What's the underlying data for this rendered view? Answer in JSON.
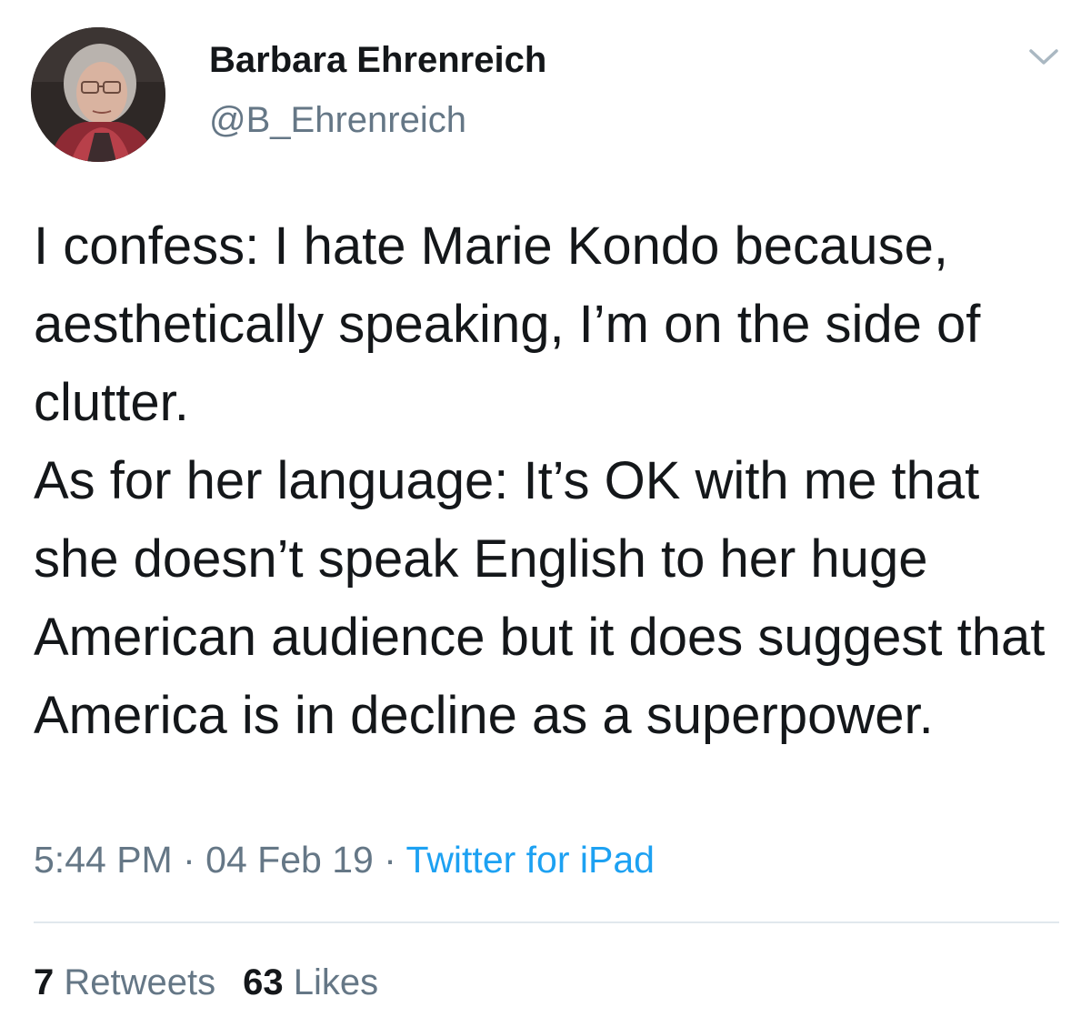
{
  "author": {
    "name": "Barbara Ehrenreich",
    "handle": "@B_Ehrenreich"
  },
  "tweet": {
    "paragraphs": [
      "I confess: I hate Marie Kondo because, aesthetically speaking, I’m on the side of clutter.",
      "As for her language: It’s OK with me that she doesn’t speak English to her huge American audience but it does suggest that America is in decline as a superpower."
    ],
    "time": "5:44 PM",
    "separator": "·",
    "date": "04 Feb 19",
    "source": "Twitter for iPad"
  },
  "stats": {
    "retweets_count": "7",
    "retweets_label": "Retweets",
    "likes_count": "63",
    "likes_label": "Likes"
  },
  "colors": {
    "text": "#14171a",
    "secondary": "#657786",
    "link": "#1da1f2",
    "divider": "#e1e8ed"
  },
  "icons": {
    "caret": "chevron-down-icon"
  }
}
